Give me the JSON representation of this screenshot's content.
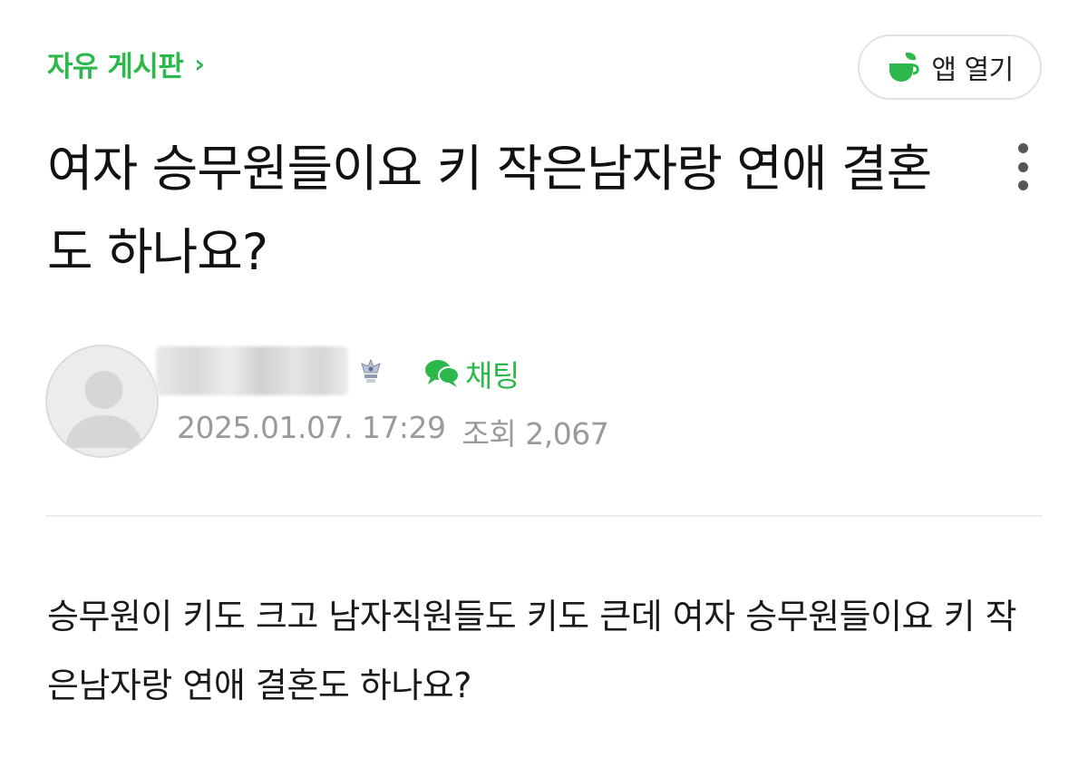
{
  "header": {
    "board_name": "자유 게시판",
    "board_chevron": "›",
    "open_app_label": "앱 열기"
  },
  "post": {
    "title": "여자 승무원들이요 키 작은남자랑 연애 결혼도 하나요?",
    "author": {
      "nickname_blurred": true,
      "chat_label": "채팅"
    },
    "date": "2025.01.07. 17:29",
    "views": "조회 2,067",
    "body": "승무원이 키도 크고 남자직원들도 키도 큰데 여자 승무원들이요 키 작은남자랑 연애 결혼도 하나요?"
  },
  "colors": {
    "accent": "#2db84b",
    "meta_text": "#9a9a9a",
    "divider": "#eeeeee"
  },
  "icons": [
    "cafe-cup-icon",
    "more-vertical-icon",
    "avatar-placeholder-icon",
    "crown-badge-icon",
    "chat-bubble-icon",
    "chevron-right-icon"
  ]
}
